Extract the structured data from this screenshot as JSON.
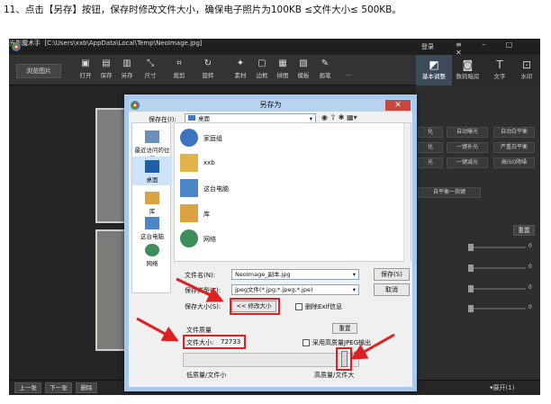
{
  "caption": "11、点击【另存】按钮，保存时修改文件大小，确保电子照片为100KB ≤文件大小≤ 500KB。",
  "app": {
    "title": "光影魔术手",
    "path": "[C:\\Users\\xxb\\AppData\\Local\\Temp\\NeoImage.jpg]",
    "login": "登录",
    "browse_button": "浏览图片",
    "toolbar": [
      "打开",
      "保存",
      "另存",
      "尺寸",
      "裁剪",
      "旋转",
      "素材",
      "边框",
      "拼图",
      "模板",
      "画笔"
    ],
    "more": "...",
    "panel_tabs": [
      "基本调整",
      "数码暗房",
      "文字",
      "水印"
    ],
    "panel_buttons": [
      "自动曝光",
      "自动白平衡",
      "一键补光",
      "严重白平衡",
      "一键减光",
      "高ISO降噪",
      "自平衡一指键"
    ],
    "panel_buttons_partial": [
      "化",
      "化",
      "光"
    ],
    "reset": "重置",
    "slider_values": [
      "0",
      "0",
      "0",
      "0"
    ],
    "bottom": {
      "prev": "上一张",
      "next": "下一张",
      "delete": "删除",
      "expand": "展开(1)"
    }
  },
  "dialog": {
    "title": "另存为",
    "close": "✕",
    "save_in_label": "保存在(I):",
    "save_in_value": "桌面",
    "places": [
      "最近访问的位置",
      "桌面",
      "库",
      "这台电脑",
      "网络"
    ],
    "files": [
      "家庭组",
      "xxb",
      "这台电脑",
      "库",
      "网络"
    ],
    "filename_label": "文件名(N):",
    "filename_value": "NeoImage_副本.jpg",
    "filetype_label": "保存类型(T):",
    "filetype_value": "jpeg文件(*.jpg;*.jpeg;*.jpe)",
    "save_button": "保存(S)",
    "cancel_button": "取消",
    "size_label": "保存大小(S):",
    "modify_size_button": "<< 修改大小",
    "exif_label": "删除Exif信息",
    "quality_label": "文件质量",
    "reset_button": "重置",
    "filesize_label": "文件大小:",
    "filesize_value": "72733",
    "hq_label": "采用高质量JPEG输出",
    "percent": "100%",
    "quality_low": "低质量/文件小",
    "quality_high": "高质量/文件大"
  }
}
